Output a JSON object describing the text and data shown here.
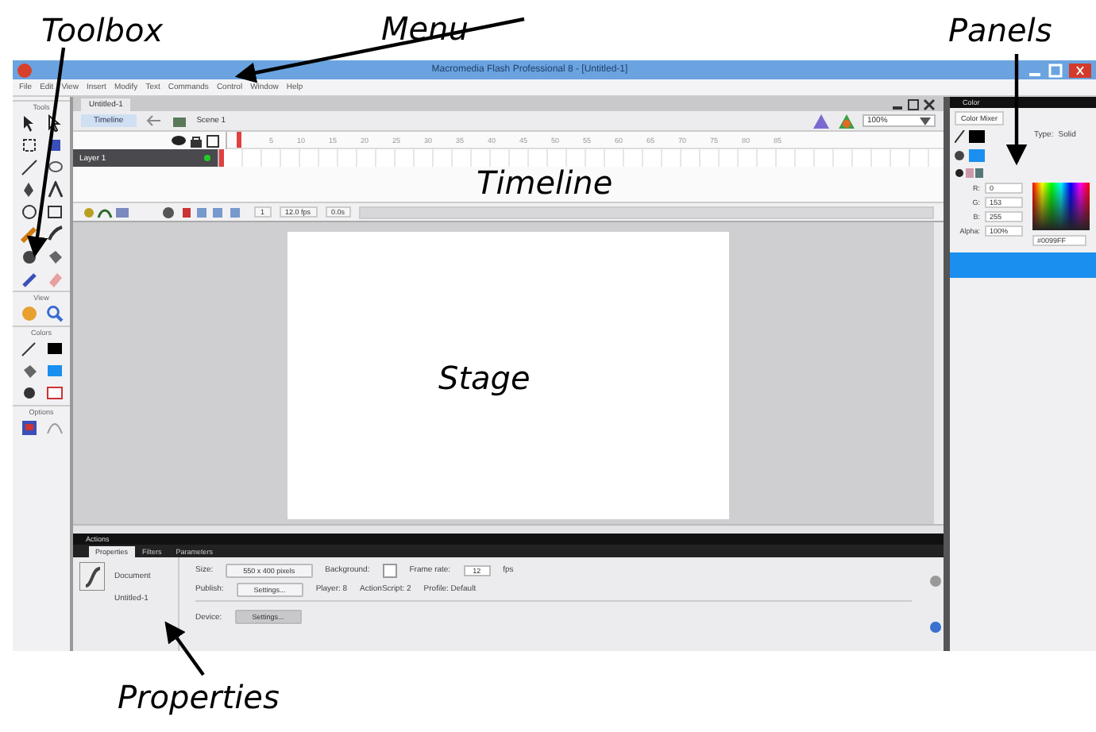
{
  "annotations": [
    {
      "text": "Toolbox",
      "kind": "toolbox"
    },
    {
      "text": "Menu",
      "kind": "menu"
    },
    {
      "text": "Panels",
      "kind": "panels"
    },
    {
      "text": "Timeline",
      "kind": "timeline"
    },
    {
      "text": "Stage",
      "kind": "stage"
    },
    {
      "text": "Properties",
      "kind": "properties"
    }
  ],
  "window": {
    "title": "Macromedia Flash Professional 8 - [Untitled-1]"
  },
  "menu": [
    "File",
    "Edit",
    "View",
    "Insert",
    "Modify",
    "Text",
    "Commands",
    "Control",
    "Window",
    "Help"
  ],
  "toolbox": {
    "title": "Tools",
    "sections": [
      "View",
      "Colors",
      "Options"
    ]
  },
  "document_tabs": [
    {
      "label": "Untitled-1",
      "selected": true
    }
  ],
  "timeline": {
    "button": "Timeline",
    "scene": "Scene 1",
    "zoom": "100%",
    "ruler": [
      "5",
      "10",
      "15",
      "20",
      "25",
      "30",
      "35",
      "40",
      "45",
      "50",
      "55",
      "60",
      "65",
      "70",
      "75",
      "80",
      "85"
    ],
    "layers": [
      {
        "name": "Layer 1",
        "selected": true
      }
    ],
    "footer": [
      "1",
      "12.0 fps",
      "0.0s"
    ]
  },
  "color_panel": {
    "title": "Color",
    "tab": "Color Mixer",
    "type_label": "Type:",
    "type": "Solid",
    "channels": [
      {
        "label": "R:",
        "value": "0"
      },
      {
        "label": "G:",
        "value": "153"
      },
      {
        "label": "B:",
        "value": "255"
      },
      {
        "label": "Alpha:",
        "value": "100%"
      }
    ],
    "hex": "#0099FF"
  },
  "properties": {
    "actions_title": "Actions",
    "tabs": [
      {
        "label": "Properties",
        "selected": true
      },
      {
        "label": "Filters",
        "selected": false
      },
      {
        "label": "Parameters",
        "selected": false
      }
    ],
    "doc_type": "Document",
    "doc_name": "Untitled-1",
    "size_label": "Size:",
    "size": "550 x 400 pixels",
    "background_label": "Background:",
    "frame_rate_label": "Frame rate:",
    "frame_rate": "12",
    "fps": "fps",
    "publish_label": "Publish:",
    "publish_button": "Settings...",
    "player": "Player: 8",
    "actionscript": "ActionScript: 2",
    "profile": "Profile: Default",
    "device_label": "Device:",
    "device_button": "Settings..."
  }
}
